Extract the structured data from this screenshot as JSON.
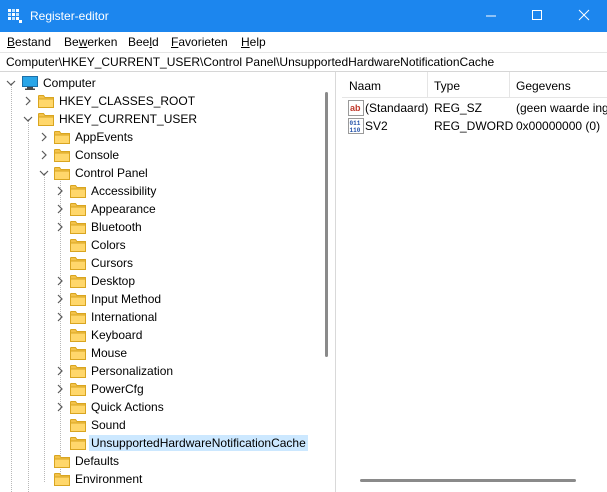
{
  "window": {
    "title": "Register-editor",
    "accent": "#1c86ee"
  },
  "menu": {
    "items": [
      {
        "accel": "B",
        "rest": "estand"
      },
      {
        "pre": "Be",
        "accel": "w",
        "rest": "erken"
      },
      {
        "pre": "Bee",
        "accel": "l",
        "rest": "d"
      },
      {
        "accel": "F",
        "rest": "avorieten"
      },
      {
        "accel": "H",
        "rest": "elp"
      }
    ]
  },
  "address": {
    "path": "Computer\\HKEY_CURRENT_USER\\Control Panel\\UnsupportedHardwareNotificationCache"
  },
  "tree": {
    "items": [
      {
        "label": "Computer",
        "icon": "computer-icon",
        "expanded": true
      },
      {
        "label": "HKEY_CLASSES_ROOT",
        "icon": "folder-icon",
        "expanded": false
      },
      {
        "label": "HKEY_CURRENT_USER",
        "icon": "folder-icon",
        "expanded": true
      },
      {
        "label": "AppEvents",
        "icon": "folder-icon",
        "expanded": false
      },
      {
        "label": "Console",
        "icon": "folder-icon",
        "expanded": false
      },
      {
        "label": "Control Panel",
        "icon": "folder-icon",
        "expanded": true
      },
      {
        "label": "Accessibility",
        "icon": "folder-icon",
        "expanded": false
      },
      {
        "label": "Appearance",
        "icon": "folder-icon",
        "expanded": false
      },
      {
        "label": "Bluetooth",
        "icon": "folder-icon",
        "expanded": false
      },
      {
        "label": "Colors",
        "icon": "folder-icon"
      },
      {
        "label": "Cursors",
        "icon": "folder-icon"
      },
      {
        "label": "Desktop",
        "icon": "folder-icon",
        "expanded": false
      },
      {
        "label": "Input Method",
        "icon": "folder-icon",
        "expanded": false
      },
      {
        "label": "International",
        "icon": "folder-icon",
        "expanded": false
      },
      {
        "label": "Keyboard",
        "icon": "folder-icon"
      },
      {
        "label": "Mouse",
        "icon": "folder-icon"
      },
      {
        "label": "Personalization",
        "icon": "folder-icon",
        "expanded": false
      },
      {
        "label": "PowerCfg",
        "icon": "folder-icon",
        "expanded": false
      },
      {
        "label": "Quick Actions",
        "icon": "folder-icon",
        "expanded": false
      },
      {
        "label": "Sound",
        "icon": "folder-icon"
      },
      {
        "label": "UnsupportedHardwareNotificationCache",
        "icon": "folder-icon",
        "selected": true
      },
      {
        "label": "Defaults",
        "icon": "folder-icon"
      },
      {
        "label": "Environment",
        "icon": "folder-icon"
      }
    ]
  },
  "values": {
    "columns": [
      "Naam",
      "Type",
      "Gegevens"
    ],
    "rows": [
      {
        "name": "(Standaard)",
        "type": "REG_SZ",
        "data": "(geen waarde ing",
        "icon": "string-value-icon"
      },
      {
        "name": "SV2",
        "type": "REG_DWORD",
        "data": "0x00000000 (0)",
        "icon": "binary-value-icon"
      }
    ]
  }
}
